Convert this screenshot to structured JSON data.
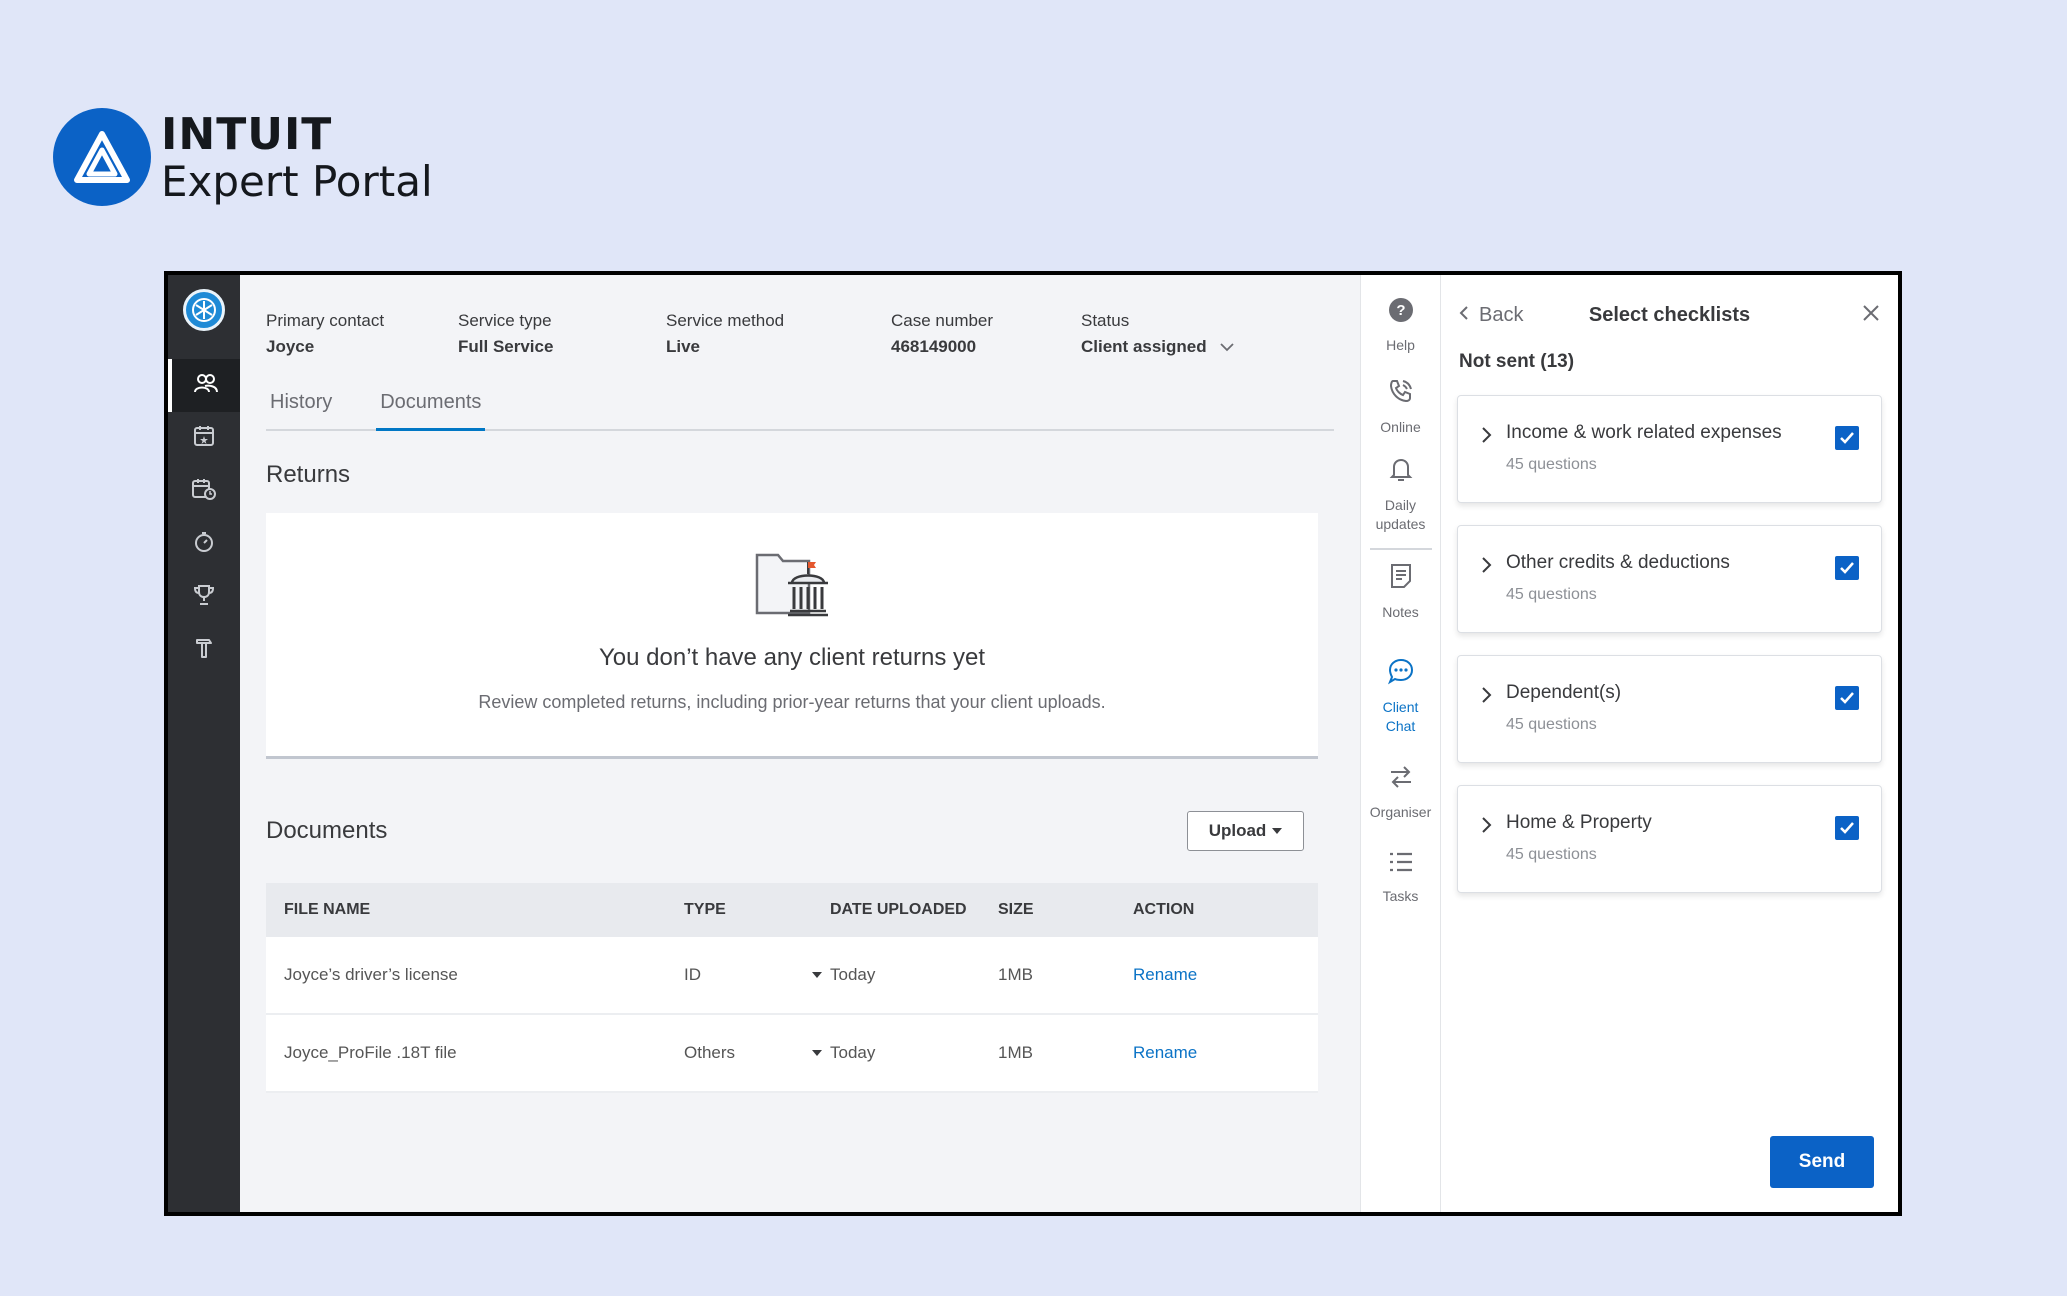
{
  "brand": {
    "wordmark": "INTUIT",
    "product": "Expert Portal"
  },
  "header": {
    "primary_contact_label": "Primary contact",
    "primary_contact_value": "Joyce",
    "service_type_label": "Service type",
    "service_type_value": "Full Service",
    "service_method_label": "Service method",
    "service_method_value": "Live",
    "case_number_label": "Case number",
    "case_number_value": "468149000",
    "status_label": "Status",
    "status_value": "Client assigned"
  },
  "tabs": [
    {
      "label": "History"
    },
    {
      "label": "Documents"
    }
  ],
  "returns": {
    "title": "Returns",
    "empty_heading": "You don’t have any client returns yet",
    "empty_desc": "Review completed returns, including prior-year returns that your client uploads."
  },
  "documents": {
    "title": "Documents",
    "upload_label": "Upload",
    "columns": [
      "FILE NAME",
      "TYPE",
      "DATE UPLOADED",
      "SIZE",
      "ACTION"
    ],
    "rows": [
      {
        "file_name": "Joyce’s driver’s license",
        "type": "ID",
        "date": "Today",
        "size": "1MB",
        "action": "Rename"
      },
      {
        "file_name": "Joyce_ProFile .18T file",
        "type": "Others",
        "date": "Today",
        "size": "1MB",
        "action": "Rename"
      }
    ]
  },
  "rail": {
    "help": "Help",
    "online": "Online",
    "daily1": "Daily",
    "daily2": "updates",
    "notes": "Notes",
    "chat1": "Client",
    "chat2": "Chat",
    "organiser": "Organiser",
    "tasks": "Tasks"
  },
  "panel": {
    "back": "Back",
    "title": "Select checklists",
    "not_sent": "Not sent (13)",
    "items": [
      {
        "title": "Income & work related expenses",
        "sub": "45 questions"
      },
      {
        "title": "Other credits & deductions",
        "sub": "45 questions"
      },
      {
        "title": "Dependent(s)",
        "sub": "45 questions"
      },
      {
        "title": "Home & Property",
        "sub": "45 questions"
      }
    ],
    "send": "Send"
  },
  "colors": {
    "accent": "#0b62c6",
    "link": "#0b73c6",
    "nav_bg": "#2d2f33",
    "page_bg": "#e0e6f8"
  }
}
